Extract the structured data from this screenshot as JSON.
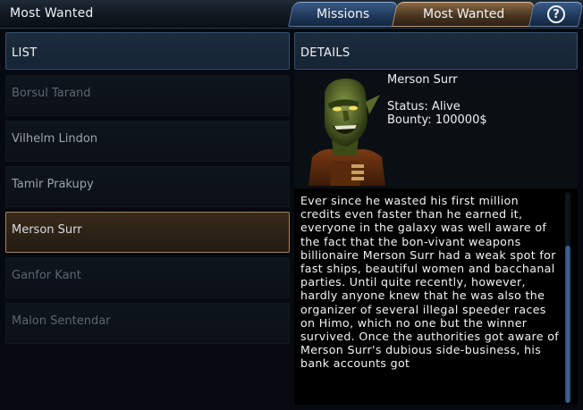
{
  "window": {
    "title": "Most Wanted"
  },
  "tabs": [
    {
      "label": "Missions",
      "active": false
    },
    {
      "label": "Most Wanted",
      "active": true
    },
    {
      "label": "?",
      "icon": "help-icon",
      "active": false
    }
  ],
  "list": {
    "header": "LIST",
    "items": [
      {
        "name": "Borsul Tarand",
        "state": "dim"
      },
      {
        "name": "Vilhelm Lindon",
        "state": "normal"
      },
      {
        "name": "Tamir Prakupy",
        "state": "normal"
      },
      {
        "name": "Merson Surr",
        "state": "selected"
      },
      {
        "name": "Ganfor Kant",
        "state": "dim"
      },
      {
        "name": "Malon Sentendar",
        "state": "dim"
      }
    ]
  },
  "details": {
    "header": "DETAILS",
    "name": "Merson Surr",
    "status": "Status: Alive",
    "bounty": "Bounty: 100000$",
    "description": "Ever since he wasted his first million credits even faster than he earned it, everyone in the galaxy was well aware of the fact that the bon-vivant weapons billionaire Merson Surr had a weak spot for fast ships, beautiful women and bacchanal parties. Until quite recently, however, hardly anyone knew that he was also the organizer of several illegal speeder races on Himo, which no one but the winner survived. Once the authorities got aware of Merson Surr's dubious side-business, his bank accounts got"
  },
  "colors": {
    "accent_blue": "#3a5a86",
    "accent_gold": "#a88252",
    "background": "#060a10"
  }
}
